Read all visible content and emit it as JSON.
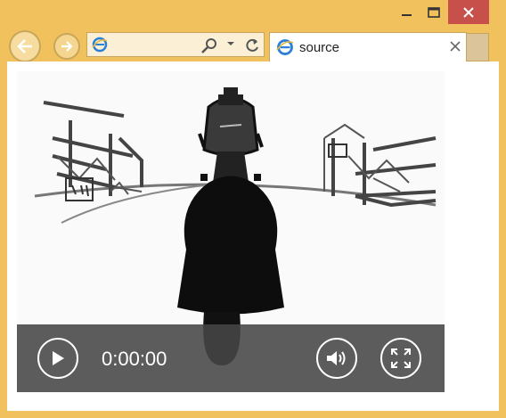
{
  "browser": {
    "tab_title": "source",
    "address_value": "",
    "colors": {
      "frame": "#f1c15d",
      "close": "#c7504b"
    },
    "icons": [
      "ie-logo-icon",
      "search-icon",
      "dropdown-icon",
      "refresh-icon",
      "back-arrow-icon",
      "forward-arrow-icon",
      "tab-close-icon",
      "minimize-icon",
      "maximize-icon",
      "close-icon"
    ]
  },
  "player": {
    "time": "0:00:00",
    "icons": [
      "play-icon",
      "volume-icon",
      "fullscreen-icon"
    ]
  }
}
